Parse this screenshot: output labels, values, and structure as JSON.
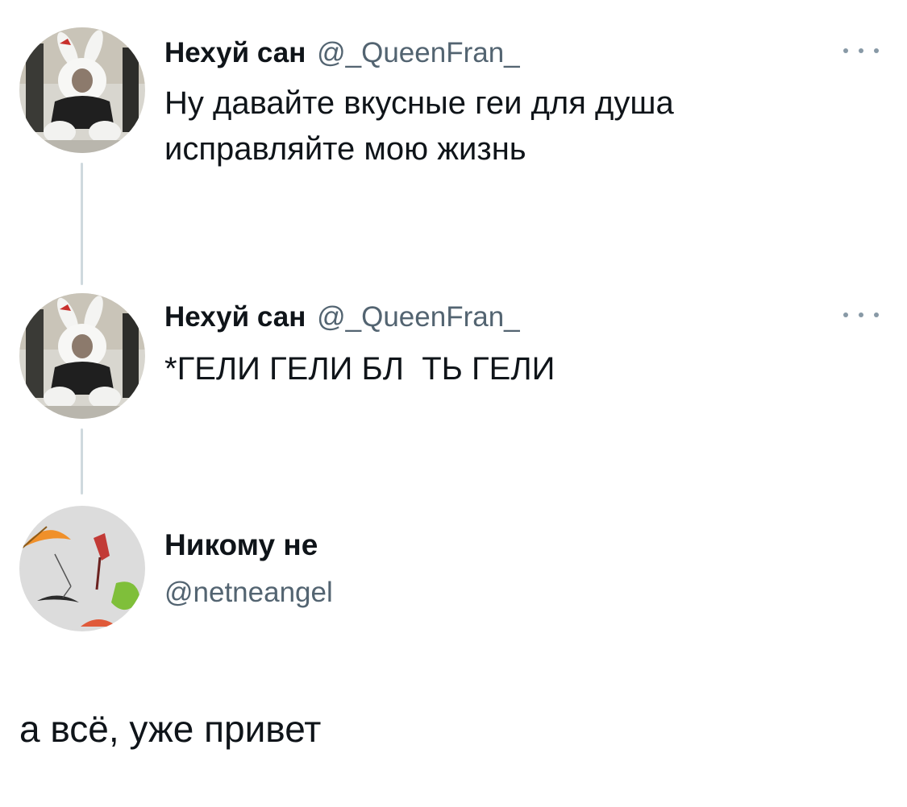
{
  "thread": [
    {
      "display_name": "Нехуй сан",
      "handle": "@_QueenFran_",
      "text": "Ну давайте вкусные геи для душа\nисправляйте мою жизнь",
      "avatar_icon": "bunny-costume-avatar",
      "more_icon": "more-horizontal-icon"
    },
    {
      "display_name": "Нехуй сан",
      "handle": "@_QueenFran_",
      "text": "*ГЕЛИ ГЕЛИ БЛ  ТЬ ГЕЛИ",
      "avatar_icon": "bunny-costume-avatar",
      "more_icon": "more-horizontal-icon"
    }
  ],
  "reply": {
    "display_name": "Никому не",
    "handle": "@netneangel",
    "text": "а всё, уже привет",
    "avatar_icon": "umbrellas-avatar"
  },
  "colors": {
    "text_primary": "#0f1419",
    "text_secondary": "#536471",
    "thread_line": "#cfd9de"
  }
}
